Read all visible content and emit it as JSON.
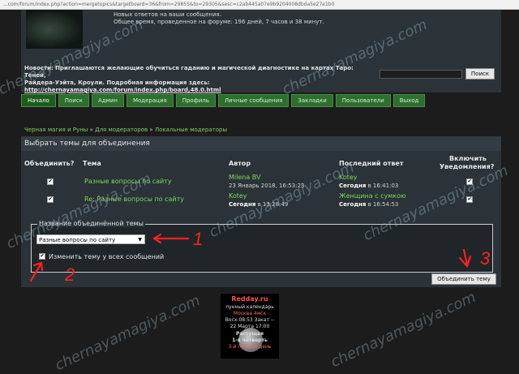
{
  "browser": {
    "url": "...com/forum/index.php?action=mergetopics&targetboard=36&from=29855&to=29305&sesc=c2ab445a07e9b9204008dbda5e27e1b0"
  },
  "header": {
    "stat_line_1": "Новых ответов на ваши сообщения.",
    "stat_line_2": "Общее время, проведенное на форуме: 196 дней, 7 часов и 38 минут.",
    "news_label": "Новости:",
    "news_line_1": "Приглашаются желающие обучиться гаданию и магической диагностике на картах Таро: Теней,",
    "news_line_2": "Райдера-Уэйта, Кроули. Подробная информация здесь:",
    "news_link": "http://chernayamagiya.com/forum/index.php/board,48.0.html",
    "search_label": "Поиск"
  },
  "nav": [
    {
      "label": "Начало",
      "active": true
    },
    {
      "label": "Поиск"
    },
    {
      "label": "Админ"
    },
    {
      "label": "Модерация"
    },
    {
      "label": "Профиль"
    },
    {
      "label": "Личные сообщения"
    },
    {
      "label": "Закладки"
    },
    {
      "label": "Пользователи"
    },
    {
      "label": "Выход"
    }
  ],
  "breadcrumb": {
    "items": [
      "Черная магия и Руны",
      "Для модераторов",
      "Локальные модераторы"
    ],
    "sep": "»"
  },
  "panel": {
    "title": "Выбрать темы для объединения",
    "col_merge": "Объединить?",
    "col_topic": "Тема",
    "col_author": "Автор",
    "col_last": "Последний ответ",
    "col_notify_1": "Включить",
    "col_notify_2": "Уведомления?",
    "rows": [
      {
        "topic": "Разные вопросы по сайту",
        "author": "Milena BV",
        "author_date": "23 Январь 2018, 16:53:23",
        "last_user": "Kotey",
        "last_date_b": "Сегодня",
        "last_date_r": " в 16:41:03"
      },
      {
        "topic": "Re: Разные вопросы по сайту",
        "author": "Kotey",
        "author_date_b": "Сегодня",
        "author_date_r": " в 13:28:49",
        "last_user": "Женщина с сумкою",
        "last_date_b": "Сегодня",
        "last_date_r": " в 16:54:53"
      }
    ],
    "check": "✔",
    "legend": "Название объединённой темы",
    "select_value": "Разные вопросы по сайту",
    "select_arrow": "▼",
    "change_label": "Изменить тему у всех сообщений",
    "merge_button": "Объединить тему"
  },
  "calendar": {
    "brand": "Redday.ru",
    "line_1": "лунный календарь",
    "line_2": "Москва 4мск",
    "line_3": "Восх:08:53 Закат --",
    "line_4": "22 Марта 17:00",
    "line_5": "Растущая",
    "line_6": "1-я четверть",
    "line_7": "3-й лунный день"
  },
  "annotations": [
    "1",
    "2",
    "3"
  ],
  "watermark": "chernayamagiya.com"
}
